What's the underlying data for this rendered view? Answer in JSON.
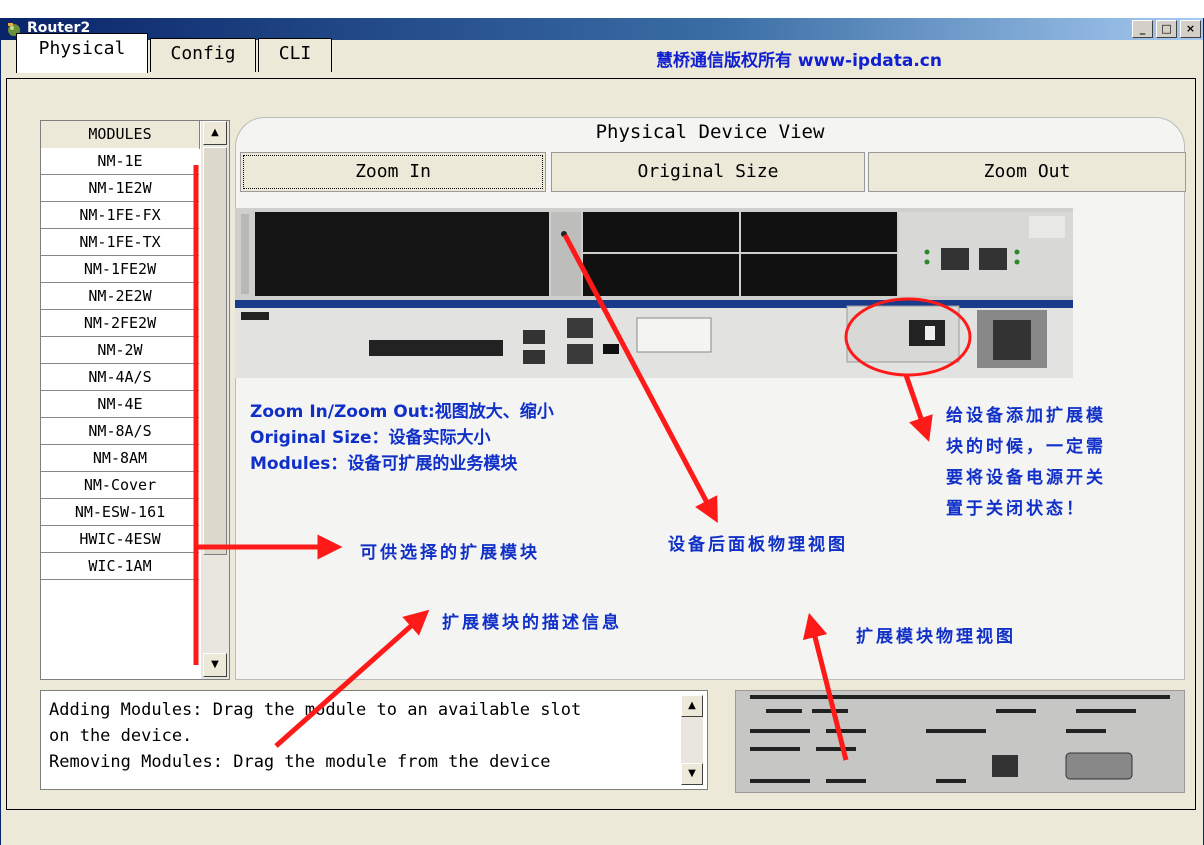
{
  "window": {
    "title": "Router2",
    "minimize": "_",
    "maximize": "□",
    "close": "×"
  },
  "tabs": [
    {
      "label": "Physical"
    },
    {
      "label": "Config"
    },
    {
      "label": "CLI"
    }
  ],
  "copyright": "慧桥通信版权所有 www-ipdata.cn",
  "modules": {
    "header": "MODULES",
    "items": [
      "NM-1E",
      "NM-1E2W",
      "NM-1FE-FX",
      "NM-1FE-TX",
      "NM-1FE2W",
      "NM-2E2W",
      "NM-2FE2W",
      "NM-2W",
      "NM-4A/S",
      "NM-4E",
      "NM-8A/S",
      "NM-8AM",
      "NM-Cover",
      "NM-ESW-161",
      "HWIC-4ESW",
      "WIC-1AM"
    ]
  },
  "device_view": {
    "title": "Physical Device View",
    "zoom_in": "Zoom In",
    "original_size": "Original Size",
    "zoom_out": "Zoom Out"
  },
  "annotations": {
    "zoom_help_1": "Zoom In/Zoom Out:视图放大、缩小",
    "zoom_help_2": "Original  Size：设备实际大小",
    "zoom_help_3": "Modules：设备可扩展的业务模块",
    "power_1": "给设备添加扩展模",
    "power_2": "块的时候，一定需",
    "power_3": "要将设备电源开关",
    "power_4": "置于关闭状态！",
    "selectable": "可供选择的扩展模块",
    "rear_panel": "设备后面板物理视图",
    "module_desc": "扩展模块的描述信息",
    "module_view": "扩展模块物理视图"
  },
  "description": {
    "line1": "Adding Modules: Drag the module to an available slot",
    "line2": "on the device.",
    "line3": "Removing Modules: Drag the module from the device"
  },
  "colors": {
    "annotation_text": "#1030c8",
    "arrow": "#ff1a1a",
    "title_bar": "#0a246a"
  }
}
